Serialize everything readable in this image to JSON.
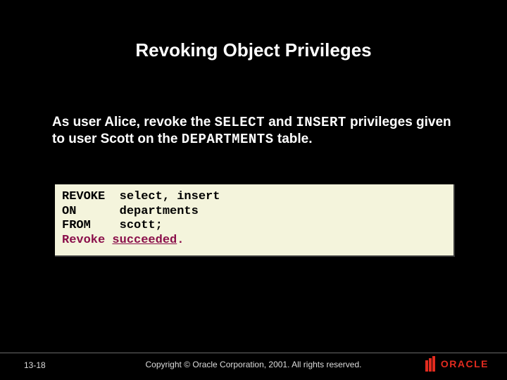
{
  "slide": {
    "title": "Revoking Object Privileges",
    "paragraph": {
      "pre1": "As user Alice, revoke the ",
      "kw1": "SELECT",
      "mid1": " and ",
      "kw2": "INSERT",
      "mid2": " privileges given to user Scott on the ",
      "kw3": "DEPARTMENTS",
      "post": " table."
    },
    "code": {
      "line1_kw": "REVOKE",
      "line1_rest": "  select, insert",
      "line2_kw": "ON",
      "line2_rest": "      departments",
      "line3_kw": "FROM",
      "line3_rest": "    scott;",
      "line4_kw": "Revoke",
      "line4_rest1": " ",
      "line4_succ": "succeeded",
      "line4_dot": "."
    },
    "footer": {
      "slide_number": "13-18",
      "copyright": "Copyright © Oracle Corporation, 2001. All rights reserved.",
      "logo_text": "ORACLE"
    }
  }
}
